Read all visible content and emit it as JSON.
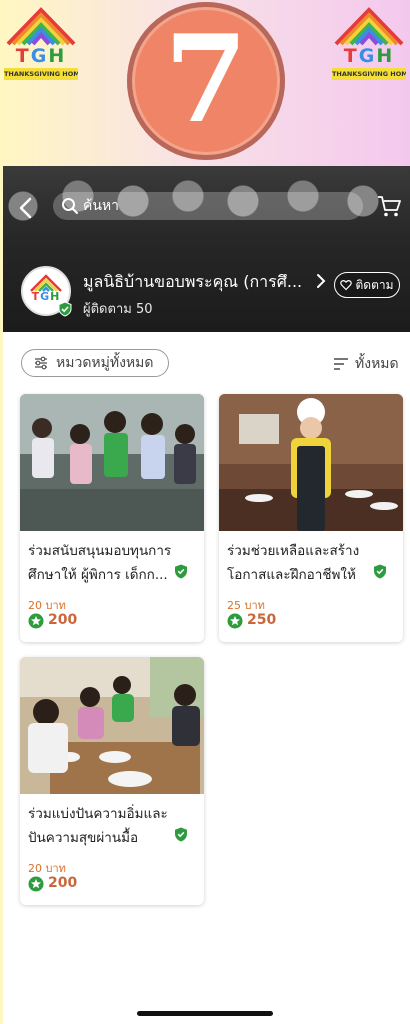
{
  "banner": {
    "logo_letters": [
      "T",
      "G",
      "H"
    ],
    "logo_subtitle": "THANKSGIVING HOME",
    "big_number": "7"
  },
  "header": {
    "search_placeholder": "ค้นหา",
    "org_name": "มูลนิธิบ้านขอบพระคุณ (การศึ...",
    "followers": "ผู้ติดตาม 50",
    "follow_label": "ติดตาม"
  },
  "filters": {
    "category_label": "หมวดหมู่ทั้งหมด",
    "sort_label": "ทั้งหมด"
  },
  "products": [
    {
      "title": "ร่วมสนับสนุนมอบทุนการศึกษาให้ ผู้พิการ เด็กก...",
      "price": "20 บาท",
      "points": "200"
    },
    {
      "title": "ร่วมช่วยเหลือและสร้างโอกาสและฝึกอาชีพให้ผู้...",
      "price": "25 บาท",
      "points": "250"
    },
    {
      "title": "ร่วมแบ่งปันความอิ่มและปันความสุขผ่านมื้ออาหาร...",
      "price": "20 บาท",
      "points": "200"
    }
  ],
  "colors": {
    "accent_orange": "#d9712b",
    "verified_green": "#2e9b3e",
    "seven_circle": "#ef8467"
  }
}
